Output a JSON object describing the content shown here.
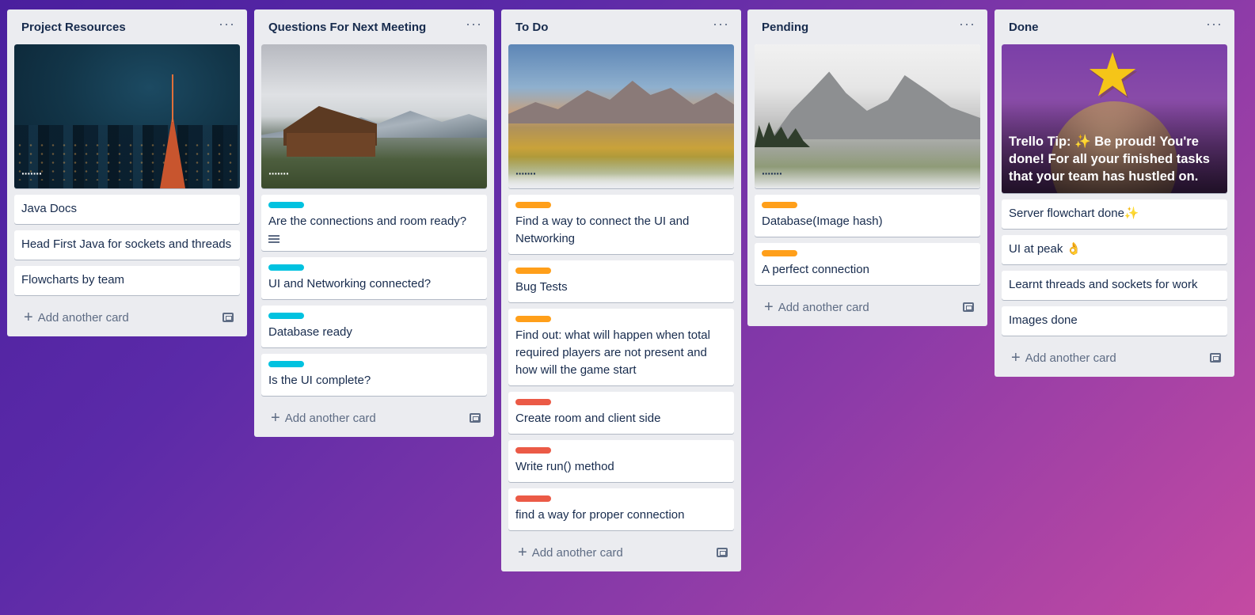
{
  "more_glyph": "···",
  "add_card_label": "Add another card",
  "plus_glyph": "+",
  "lists": [
    {
      "title": "Project Resources",
      "cover_dots": "·······",
      "cards": [
        "Java Docs",
        "Head First Java for sockets and threads",
        "Flowcharts by team"
      ]
    },
    {
      "title": "Questions For Next Meeting",
      "cover_dots": "·······",
      "cards": [
        "Are the connections and room ready?",
        "UI and Networking connected?",
        "Database ready",
        "Is the UI complete?"
      ]
    },
    {
      "title": "To Do",
      "cover_dots": "·······",
      "cards": [
        "Find a way to connect the UI and Networking",
        "Bug Tests",
        "Find out: what will happen when total required players are not present and how will the game start",
        "Create room and client side",
        "Write run() method",
        "find a way for proper connection"
      ]
    },
    {
      "title": "Pending",
      "cover_dots": "·······",
      "cards": [
        "Database(Image hash)",
        "A perfect connection"
      ]
    },
    {
      "title": "Done",
      "tip_text": "Trello Tip: ✨ Be proud! You're done! For all your finished tasks that your team has hustled on.",
      "star": "★",
      "cards": [
        "Server flowchart done✨",
        "UI at peak 👌",
        "Learnt threads and sockets for work",
        "Images done"
      ]
    }
  ],
  "colors": {
    "label_cyan": "#00c2e0",
    "label_orange": "#ff9f1a",
    "label_red": "#eb5a46",
    "list_bg": "#ebecf0"
  }
}
